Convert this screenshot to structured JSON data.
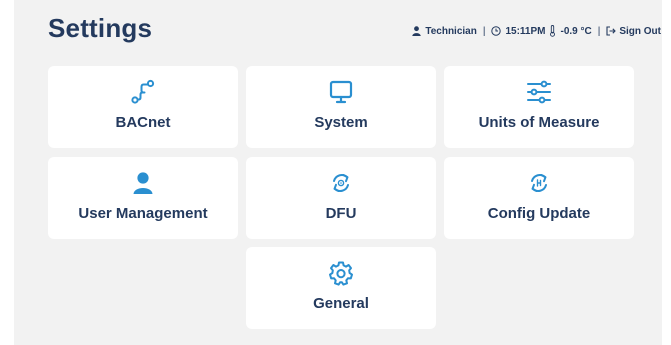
{
  "header": {
    "title": "Settings",
    "user": "Technician",
    "time": "15:11PM",
    "temperature": "-0.9 °C",
    "separator": "|",
    "sign_out": "Sign Out"
  },
  "colors": {
    "accent": "#2a8fd0",
    "text": "#243a5e",
    "panel": "#f2f2f2",
    "tile": "#ffffff"
  },
  "tiles": [
    {
      "label": "BACnet",
      "icon": "bacnet-network-icon"
    },
    {
      "label": "System",
      "icon": "monitor-icon"
    },
    {
      "label": "Units of Measure",
      "icon": "sliders-icon"
    },
    {
      "label": "User Management",
      "icon": "user-icon"
    },
    {
      "label": "DFU",
      "icon": "firmware-update-icon"
    },
    {
      "label": "Config Update",
      "icon": "config-update-icon"
    },
    {
      "label": "General",
      "icon": "gear-icon"
    }
  ]
}
